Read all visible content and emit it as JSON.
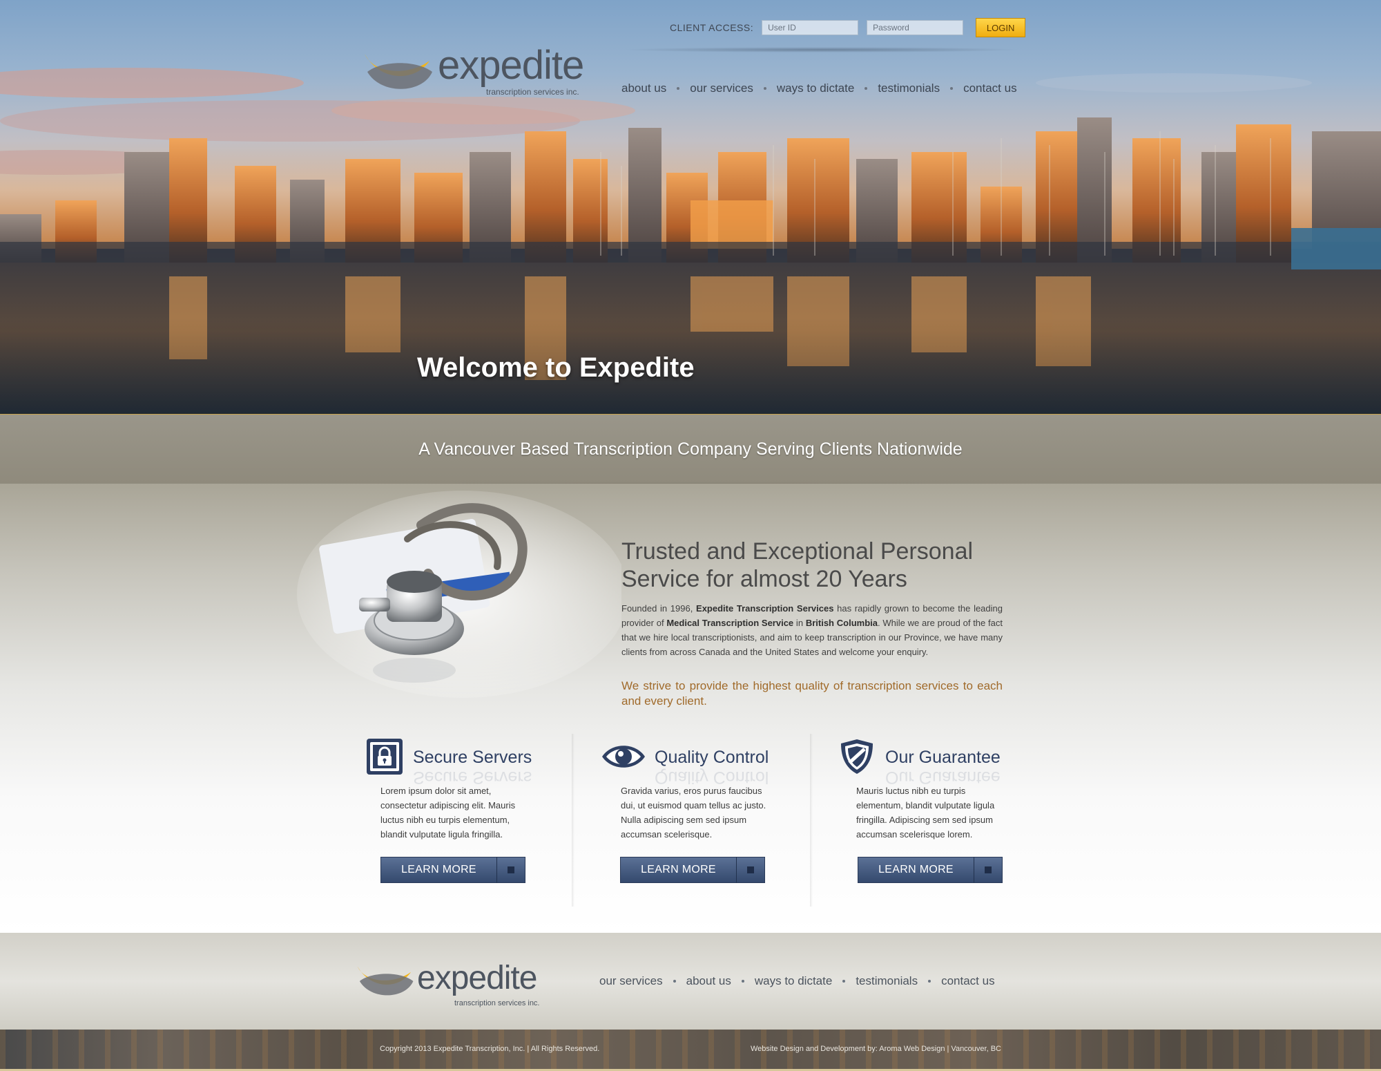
{
  "header": {
    "client_access_label": "CLIENT ACCESS:",
    "user_id_placeholder": "User ID",
    "password_placeholder": "Password",
    "login_label": "LOGIN"
  },
  "logo": {
    "wordmark": "expedite",
    "tagline": "transcription services inc."
  },
  "nav": [
    {
      "label": "about us"
    },
    {
      "label": "our services"
    },
    {
      "label": "ways to dictate"
    },
    {
      "label": "testimonials"
    },
    {
      "label": "contact us"
    }
  ],
  "hero": {
    "welcome": "Welcome to Expedite",
    "tagline": "A Vancouver Based Transcription Company Serving Clients Nationwide"
  },
  "intro": {
    "title_line1": "Trusted and Exceptional Personal",
    "title_line2": "Service for almost 20 Years",
    "body_parts": [
      "Founded in 1996, ",
      "Expedite Transcription Services",
      " has rapidly grown to become the leading provider of ",
      "Medical Transcription Service",
      " in ",
      "British Columbia",
      ". While we are proud of the fact that we hire local transcriptionists, and aim to keep transcription in our Province, we have many clients from across Canada and the United States and welcome your enquiry."
    ],
    "quote": "We strive to provide the highest quality of transcription services to each and every client."
  },
  "features": [
    {
      "title": "Secure Servers",
      "icon": "lock-icon",
      "text": "Lorem ipsum dolor sit amet, consectetur adipiscing elit. Mauris luctus nibh eu turpis elementum, blandit vulputate ligula fringilla.",
      "button": "LEARN MORE"
    },
    {
      "title": "Quality Control",
      "icon": "eye-icon",
      "text": "Gravida varius, eros purus faucibus dui, ut euismod quam tellus ac justo. Nulla adipiscing sem sed ipsum accumsan scelerisque.",
      "button": "LEARN MORE"
    },
    {
      "title": "Our Guarantee",
      "icon": "shield-icon",
      "text": "Mauris luctus nibh eu turpis elementum, blandit vulputate ligula fringilla. Adipiscing sem sed ipsum accumsan scelerisque lorem.",
      "button": "LEARN MORE"
    }
  ],
  "footer_nav": [
    {
      "label": "our services"
    },
    {
      "label": "about us"
    },
    {
      "label": "ways to dictate"
    },
    {
      "label": "testimonials"
    },
    {
      "label": "contact us"
    }
  ],
  "copyright": "Copyright 2013  Expedite Transcription, Inc.  |  All Rights Reserved.",
  "credits": "Website Design and Development by: Aroma Web Design  |  Vancouver, BC",
  "colors": {
    "accent_gold": "#f0ad10",
    "brand_navy": "#34496d",
    "quote_brown": "#a06a2a"
  }
}
